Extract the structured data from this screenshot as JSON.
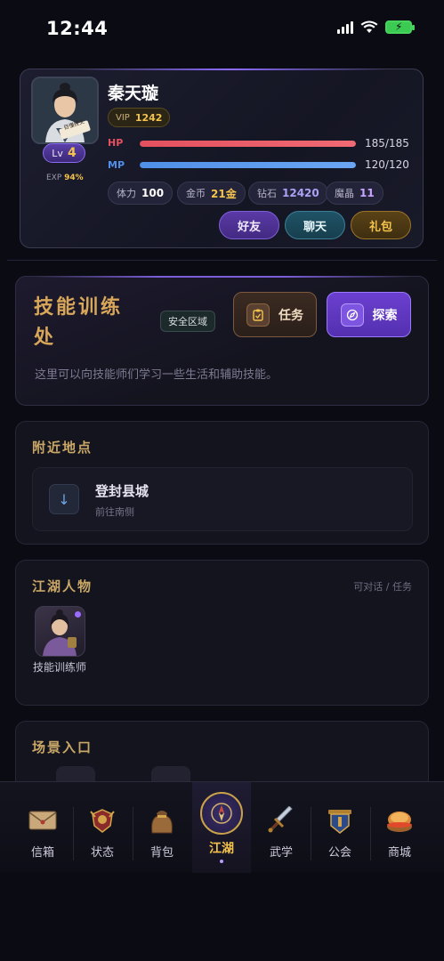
{
  "status_bar": {
    "time": "12:44"
  },
  "profile": {
    "name": "秦天璇",
    "vip_label": "VIP",
    "vip_value": "1242",
    "lv_label": "Lv",
    "level": "4",
    "exp_label": "EXP",
    "exp_percent": "94%",
    "hp_label": "HP",
    "hp_value": "185/185",
    "hp_fraction": 1.0,
    "mp_label": "MP",
    "mp_value": "120/120",
    "mp_fraction": 1.0,
    "stats": [
      {
        "label": "体力",
        "value": "100"
      },
      {
        "label": "金币",
        "value": "21金"
      },
      {
        "label": "钻石",
        "value": "12420"
      },
      {
        "label": "魔晶",
        "value": "11"
      }
    ],
    "avatar_scroll_text": "目懂技文",
    "actions": {
      "friends": "好友",
      "chat": "聊天",
      "gift": "礼包"
    }
  },
  "location": {
    "title": "技能训练处",
    "safe_badge": "安全区域",
    "task_button": "任务",
    "explore_button": "探索",
    "description": "这里可以向技能师们学习一些生活和辅助技能。"
  },
  "nearby": {
    "title": "附近地点",
    "places": [
      {
        "name": "登封县城",
        "sub": "前往南侧"
      }
    ]
  },
  "characters": {
    "title": "江湖人物",
    "hint": "可对话 / 任务",
    "npcs": [
      {
        "name": "技能训练师"
      }
    ]
  },
  "scenes": {
    "title": "场景入口"
  },
  "bottom_nav": [
    {
      "label": "信箱",
      "icon": "mail-icon"
    },
    {
      "label": "状态",
      "icon": "status-icon"
    },
    {
      "label": "背包",
      "icon": "bag-icon"
    },
    {
      "label": "江湖",
      "icon": "compass-icon",
      "active": true
    },
    {
      "label": "武学",
      "icon": "sword-icon"
    },
    {
      "label": "公会",
      "icon": "guild-icon"
    },
    {
      "label": "商城",
      "icon": "shop-icon"
    }
  ],
  "colors": {
    "hp": "#e4505e",
    "mp": "#4f8fe8",
    "gold": "#f3c34b",
    "accent_purple": "#6b3fd0"
  }
}
